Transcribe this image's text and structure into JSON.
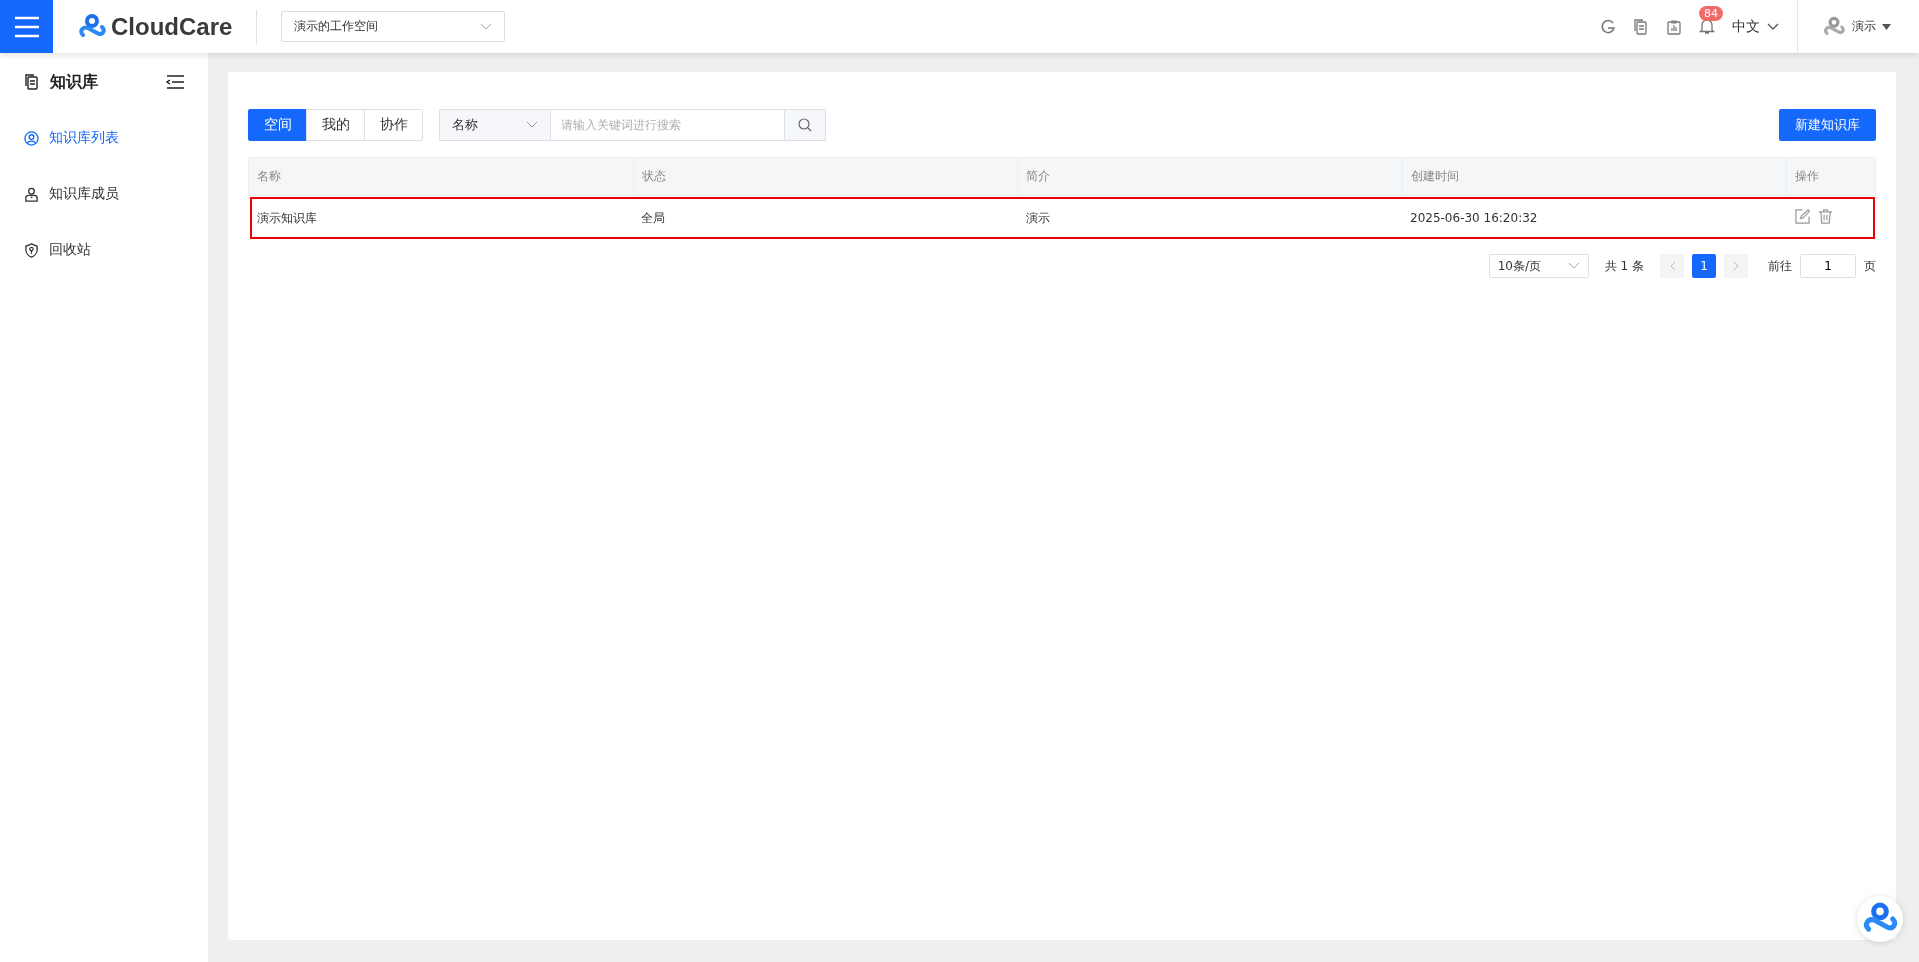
{
  "header": {
    "logo": "CloudCare",
    "workspace": "演示的工作空间",
    "notification_count": "84",
    "language": "中文",
    "user": "演示"
  },
  "sidebar": {
    "title": "知识库",
    "items": [
      {
        "label": "知识库列表",
        "kind": "list",
        "selected": true
      },
      {
        "label": "知识库成员",
        "kind": "members",
        "selected": false
      },
      {
        "label": "回收站",
        "kind": "recycle",
        "selected": false
      }
    ]
  },
  "tabs": [
    {
      "label": "空间",
      "selected": true
    },
    {
      "label": "我的",
      "selected": false
    },
    {
      "label": "协作",
      "selected": false
    }
  ],
  "search": {
    "field": "名称",
    "placeholder": "请输入关键词进行搜索"
  },
  "new_button": "新建知识库",
  "table": {
    "columns": [
      "名称",
      "状态",
      "简介",
      "创建时间",
      "操作"
    ],
    "rows": [
      {
        "cells": [
          "演示知识库",
          "全局",
          "演示",
          "2025-06-30 16:20:32"
        ],
        "selected": true
      }
    ]
  },
  "pagination": {
    "page_size": "10条/页",
    "total": "共 1 条",
    "pages": [
      {
        "label": "1",
        "selected": true
      }
    ],
    "goto_label": "前往",
    "goto_value": "1",
    "page_suffix": "页"
  }
}
